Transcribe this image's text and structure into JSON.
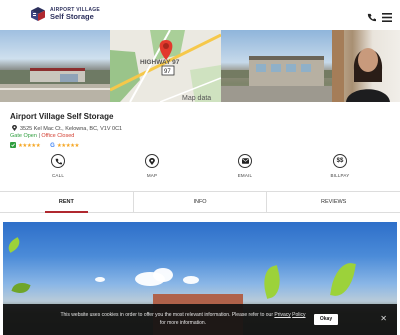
{
  "header": {
    "logo_line1": "AIRPORT VILLAGE",
    "logo_line2": "Self Storage",
    "icons": [
      "phone-icon",
      "menu-icon"
    ]
  },
  "photos": {
    "map_road_label": "HIGHWAY 97",
    "map_shield": "97",
    "map_watermark": "Map data"
  },
  "facility": {
    "name": "Airport Village Self Storage",
    "address": "3525 Kel Mac Ct., Kelowna, BC, V1V 0C1",
    "gate_status": "Gate Open",
    "separator": "|",
    "office_status": "Office Closed",
    "rating_stars_1": "★★★★★",
    "rating_stars_2": "★★★★★",
    "google_label": "G"
  },
  "actions": [
    {
      "label": "CALL",
      "icon": "phone-icon"
    },
    {
      "label": "MAP",
      "icon": "map-pin-icon"
    },
    {
      "label": "EMAIL",
      "icon": "email-icon"
    },
    {
      "label": "BILLPAY",
      "icon": "dollar-icon",
      "glyph": "$$"
    }
  ],
  "tabs": [
    {
      "label": "RENT",
      "active": true
    },
    {
      "label": "INFO",
      "active": false
    },
    {
      "label": "REVIEWS",
      "active": false
    }
  ],
  "cookie": {
    "text_before": "This website uses cookies in order to offer you the most relevant information. Please refer to our ",
    "link1": "Privacy",
    "link2": "Policy",
    "text_after": " for more information.",
    "okay_label": "Okay",
    "close_icon": "close-icon"
  },
  "colors": {
    "brand_navy": "#2b2f5c",
    "accent_red": "#b0282f",
    "gate_open": "#2e9e3e",
    "office_closed": "#d23c2f",
    "star": "#f5a623"
  }
}
